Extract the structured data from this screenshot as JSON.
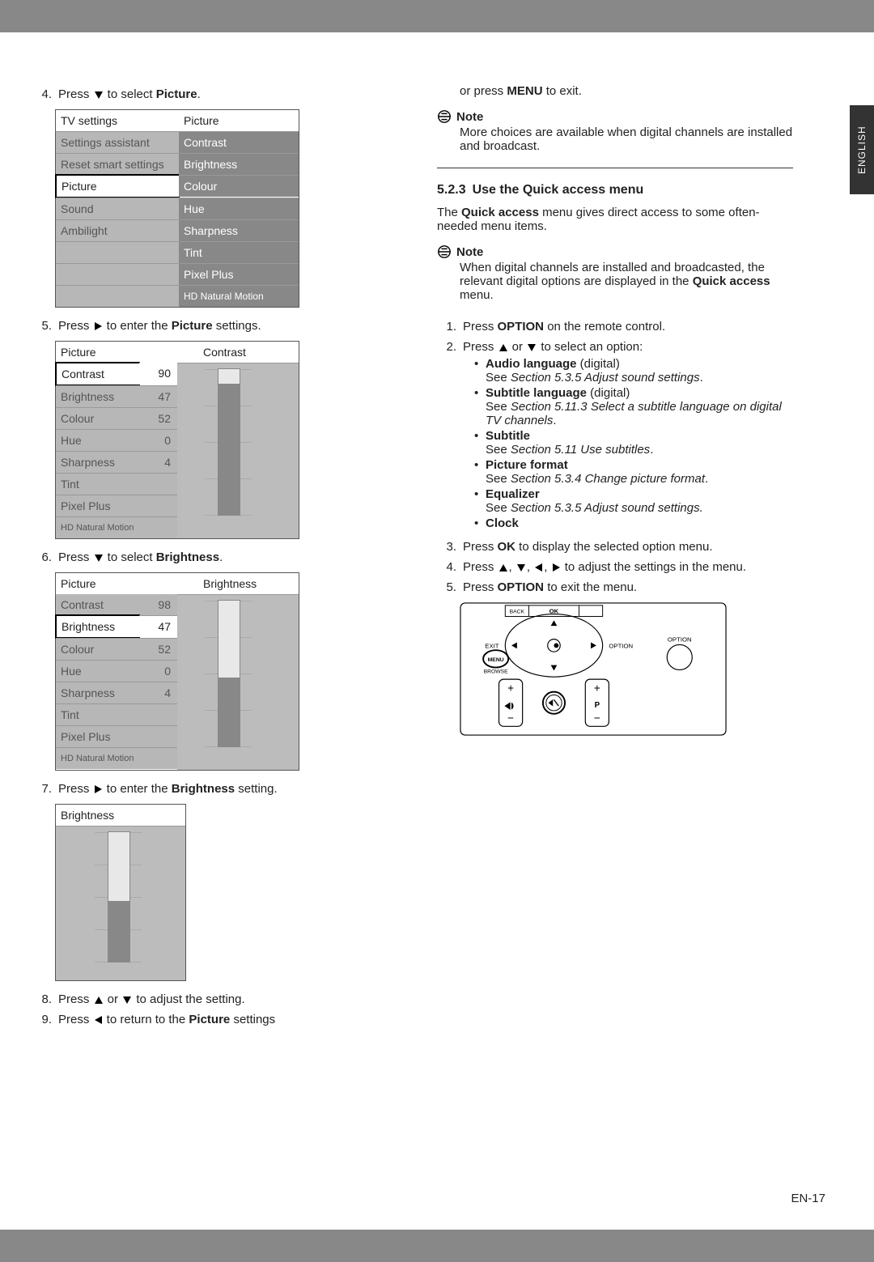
{
  "side_tab": "ENGLISH",
  "page_number": "EN-17",
  "steps_left": {
    "s4": {
      "num": "4.",
      "text_a": "Press ",
      "text_b": " to select ",
      "bold": "Picture",
      "text_c": "."
    },
    "s5": {
      "num": "5.",
      "text_a": "Press ",
      "text_b": " to enter the ",
      "bold": "Picture",
      "text_c": " settings."
    },
    "s6": {
      "num": "6.",
      "text_a": "Press ",
      "text_b": " to select ",
      "bold": "Brightness",
      "text_c": "."
    },
    "s7": {
      "num": "7.",
      "text_a": "Press ",
      "text_b": " to enter the ",
      "bold": "Brightness",
      "text_c": " setting."
    },
    "s8": {
      "num": "8.",
      "text_a": "Press ",
      "text_b": " or ",
      "text_c": " to adjust the setting."
    },
    "s9": {
      "num": "9.",
      "text_a": "Press ",
      "text_b": " to return to the ",
      "bold": "Picture",
      "text_c": " settings"
    }
  },
  "menu1": {
    "header_a": "TV settings",
    "header_b": "Picture",
    "rows": [
      {
        "a": "Settings assistant",
        "b": "Contrast",
        "a_cls": "grey-cell",
        "b_cls": "dgrey-cell"
      },
      {
        "a": "Reset smart settings",
        "b": "Brightness",
        "a_cls": "grey-cell",
        "b_cls": "dgrey-cell"
      },
      {
        "a": "Picture",
        "b": "Colour",
        "a_cls": "white-cell selected-left",
        "b_cls": "dgrey-cell"
      },
      {
        "a": "Sound",
        "b": "Hue",
        "a_cls": "grey-cell",
        "b_cls": "dgrey-cell"
      },
      {
        "a": "Ambilight",
        "b": "Sharpness",
        "a_cls": "grey-cell",
        "b_cls": "dgrey-cell"
      },
      {
        "a": "",
        "b": "Tint",
        "a_cls": "grey-cell",
        "b_cls": "dgrey-cell"
      },
      {
        "a": "",
        "b": "Pixel Plus",
        "a_cls": "grey-cell",
        "b_cls": "dgrey-cell"
      },
      {
        "a": "",
        "b": "HD Natural Motion",
        "a_cls": "grey-cell",
        "b_cls": "dgrey-cell"
      }
    ]
  },
  "menu2a": {
    "header_a": "Picture",
    "header_b": "Contrast",
    "bar_fill": "90%",
    "rows": [
      {
        "a": "Contrast",
        "v": "90",
        "a_cls": "white-cell selected-left"
      },
      {
        "a": "Brightness",
        "v": "47",
        "a_cls": "grey-cell"
      },
      {
        "a": "Colour",
        "v": "52",
        "a_cls": "grey-cell"
      },
      {
        "a": "Hue",
        "v": "0",
        "a_cls": "grey-cell"
      },
      {
        "a": "Sharpness",
        "v": "4",
        "a_cls": "grey-cell"
      },
      {
        "a": "Tint",
        "v": "",
        "a_cls": "grey-cell"
      },
      {
        "a": "Pixel Plus",
        "v": "",
        "a_cls": "grey-cell"
      },
      {
        "a": "HD Natural Motion",
        "v": "",
        "a_cls": "grey-cell"
      }
    ]
  },
  "menu2b": {
    "header_a": "Picture",
    "header_b": "Brightness",
    "bar_fill": "47%",
    "rows": [
      {
        "a": "Contrast",
        "v": "98",
        "a_cls": "grey-cell"
      },
      {
        "a": "Brightness",
        "v": "47",
        "a_cls": "white-cell selected-left"
      },
      {
        "a": "Colour",
        "v": "52",
        "a_cls": "grey-cell"
      },
      {
        "a": "Hue",
        "v": "0",
        "a_cls": "grey-cell"
      },
      {
        "a": "Sharpness",
        "v": "4",
        "a_cls": "grey-cell"
      },
      {
        "a": "Tint",
        "v": "",
        "a_cls": "grey-cell"
      },
      {
        "a": "Pixel Plus",
        "v": "",
        "a_cls": "grey-cell"
      },
      {
        "a": "HD Natural Motion",
        "v": "",
        "a_cls": "grey-cell"
      }
    ]
  },
  "menu3": {
    "header": "Brightness",
    "bar_fill": "47%"
  },
  "right": {
    "top_line_a": "or press ",
    "top_bold": "MENU",
    "top_line_b": " to exit.",
    "note1_head": "Note",
    "note1_body": "More choices are available when digital channels are installed and broadcast.",
    "section_num": "5.2.3",
    "section_title": "Use the Quick access menu",
    "para1_a": "The ",
    "para1_bold": "Quick access",
    "para1_b": " menu gives direct access to some often-needed menu items.",
    "note2_head": "Note",
    "note2_body_a": "When digital channels are installed and broadcasted, the relevant digital options are displayed in the ",
    "note2_bold": "Quick access",
    "note2_body_b": " menu.",
    "s1": {
      "num": "1.",
      "a": "Press ",
      "bold": "OPTION",
      "b": " on the remote control."
    },
    "s2": {
      "num": "2.",
      "a": "Press ",
      "b": " or ",
      "c": " to select an option:"
    },
    "s2_items": [
      {
        "bold": "Audio language",
        "extra": " (digital)",
        "note_a": "See ",
        "ital": "Section 5.3.5 Adjust sound settings",
        "note_b": "."
      },
      {
        "bold": "Subtitle language",
        "extra": " (digital)",
        "note_a": "See ",
        "ital": "Section 5.11.3 Select a subtitle language on digital TV channels",
        "note_b": "."
      },
      {
        "bold": "Subtitle",
        "extra": "",
        "note_a": "See ",
        "ital": "Section 5.11 Use subtitles",
        "note_b": "."
      },
      {
        "bold": "Picture format",
        "extra": "",
        "note_a": "See ",
        "ital": "Section 5.3.4 Change picture format",
        "note_b": "."
      },
      {
        "bold": "Equalizer",
        "extra": "",
        "note_a": "See ",
        "ital": "Section 5.3.5 Adjust sound settings.",
        "note_b": ""
      },
      {
        "bold": "Clock",
        "extra": "",
        "note_a": "",
        "ital": "",
        "note_b": ""
      }
    ],
    "s3": {
      "num": "3.",
      "a": "Press ",
      "bold": "OK",
      "b": " to display the selected option menu."
    },
    "s4": {
      "num": "4.",
      "a": "Press ",
      "b": " to adjust the settings in the menu."
    },
    "s5": {
      "num": "5.",
      "a": "Press ",
      "bold": "OPTION",
      "b": " to exit the menu."
    },
    "remote_labels": {
      "back": "BACK",
      "ok": "OK",
      "exit": "EXIT",
      "option": "OPTION",
      "menu": "MENU",
      "browse": "BROWSE",
      "p": "P",
      "ok_btn": "OK"
    }
  }
}
